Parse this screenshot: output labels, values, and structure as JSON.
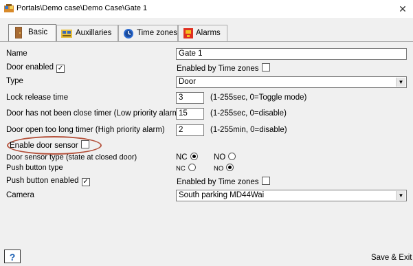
{
  "window": {
    "title": "Portals\\Demo case\\Demo Case\\Gate 1",
    "close_glyph": "✕"
  },
  "tabs": [
    {
      "label": "Basic",
      "icon": "door-icon",
      "active": true
    },
    {
      "label": "Auxillaries",
      "icon": "auxillaries-icon",
      "active": false
    },
    {
      "label": "Time zones",
      "icon": "clock-icon",
      "active": false
    },
    {
      "label": "Alarms",
      "icon": "alarm-icon",
      "active": false
    }
  ],
  "form": {
    "name_label": "Name",
    "name_value": "Gate 1",
    "door_enabled_label": "Door enabled",
    "door_enabled_checked": true,
    "enabled_by_tz_label": "Enabled by Time zones",
    "enabled_by_tz_checked": false,
    "type_label": "Type",
    "type_value": "Door",
    "lock_release_label": "Lock release time",
    "lock_release_value": "3",
    "lock_release_hint": "(1-255sec, 0=Toggle mode)",
    "door_close_timer_label": "Door has not been close timer (Low priority alarm)",
    "door_close_timer_value": "15",
    "door_close_timer_hint": "(1-255sec, 0=disable)",
    "door_open_timer_label": "Door open too long timer (High priority alarm)",
    "door_open_timer_value": "2",
    "door_open_timer_hint": "(1-255min, 0=disable)",
    "door_sensor_label": "Enable door sensor",
    "door_sensor_checked": false,
    "sensor_type_label": "Door sensor type (state at closed door)",
    "sensor_nc_label": "NC",
    "sensor_no_label": "NO",
    "sensor_selected": "NC",
    "push_type_label": "Push button type",
    "push_nc_label": "NC",
    "push_no_label": "NO",
    "push_selected": "NO",
    "push_enabled_label": "Push button enabled",
    "push_enabled_checked": true,
    "push_enabled_by_tz_label": "Enabled by Time zones",
    "push_enabled_by_tz_checked": false,
    "camera_label": "Camera",
    "camera_value": "South parking  MD44Wai"
  },
  "footer": {
    "help_label": "?",
    "save_label": "Save & Exit"
  },
  "colors": {
    "highlight": "#b5533d",
    "panel_bg": "#f0f0f0"
  }
}
